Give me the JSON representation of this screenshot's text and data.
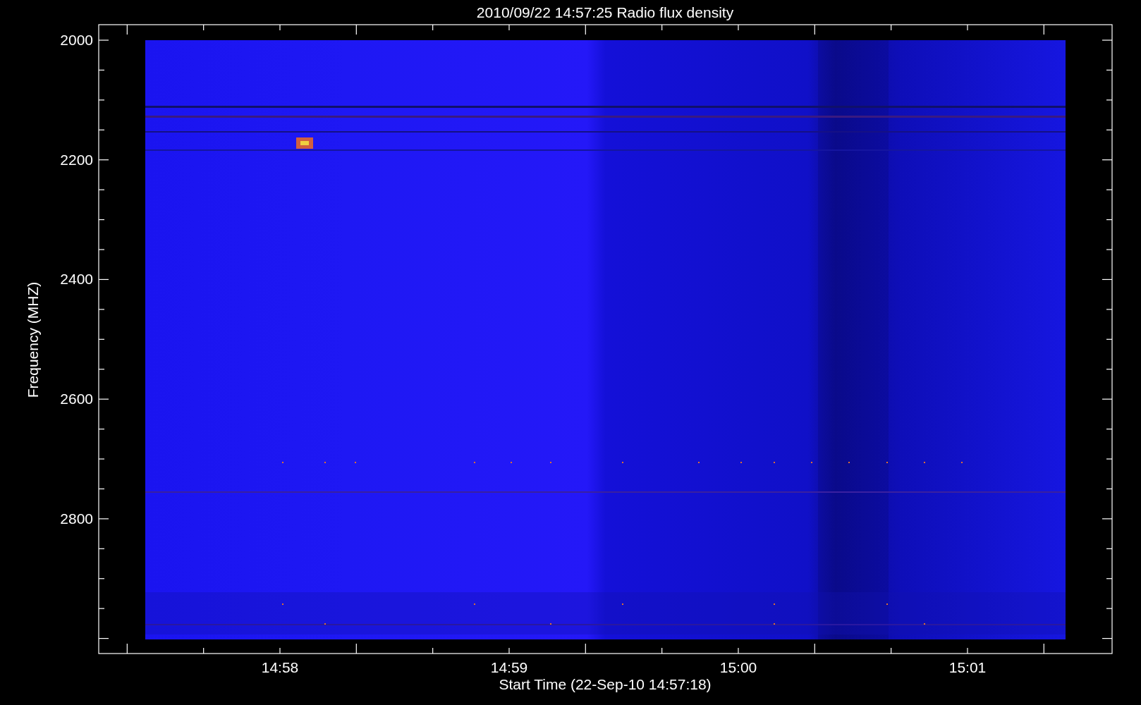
{
  "title": "2010/09/22 14:57:25 Radio flux density",
  "y_axis": {
    "label": "Frequency (MHZ)",
    "ticks": [
      "2000",
      "2200",
      "2400",
      "2600",
      "2800"
    ]
  },
  "x_axis": {
    "label": "Start Time (22-Sep-10 14:57:18)",
    "ticks": [
      "14:58",
      "14:59",
      "15:00",
      "15:01"
    ]
  }
}
